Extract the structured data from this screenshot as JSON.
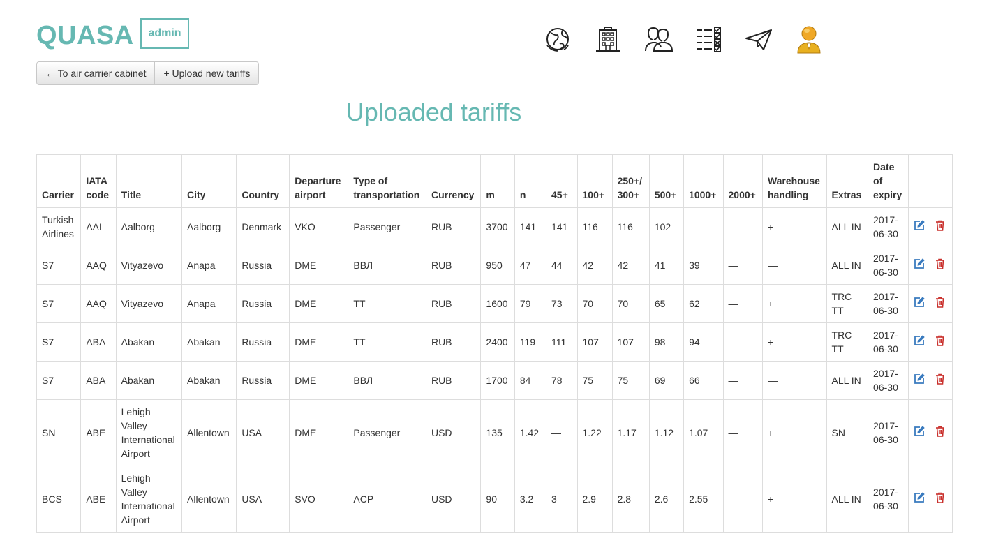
{
  "brand": {
    "logo": "QUASA",
    "role": "admin"
  },
  "toolbar": {
    "back_label": "← To air carrier cabinet",
    "upload_label": "+ Upload new tariffs"
  },
  "nav_icons": [
    "globe-icon",
    "building-icon",
    "users-icon",
    "checklist-icon",
    "paper-plane-icon",
    "user-avatar-icon"
  ],
  "colors": {
    "accent": "#66b8b2",
    "edit": "#3a7bbf",
    "delete": "#c9302c",
    "avatar": "#e8b020"
  },
  "page": {
    "title": "Uploaded tariffs"
  },
  "table": {
    "headers": [
      "Carrier",
      "IATA code",
      "Title",
      "City",
      "Country",
      "Departure airport",
      "Type of transportation",
      "Currency",
      "m",
      "n",
      "45+",
      "100+",
      "250+/ 300+",
      "500+",
      "1000+",
      "2000+",
      "Warehouse handling",
      "Extras",
      "Date of expiry"
    ],
    "rows": [
      [
        "Turkish Airlines",
        "AAL",
        "Aalborg",
        "Aalborg",
        "Denmark",
        "VKO",
        "Passenger",
        "RUB",
        "3700",
        "141",
        "141",
        "116",
        "116",
        "102",
        "—",
        "—",
        "+",
        "ALL IN",
        "2017-06-30"
      ],
      [
        "S7",
        "AAQ",
        "Vityazevo",
        "Anapa",
        "Russia",
        "DME",
        "ВВЛ",
        "RUB",
        "950",
        "47",
        "44",
        "42",
        "42",
        "41",
        "39",
        "—",
        "—",
        "ALL IN",
        "2017-06-30"
      ],
      [
        "S7",
        "AAQ",
        "Vityazevo",
        "Anapa",
        "Russia",
        "DME",
        "TT",
        "RUB",
        "1600",
        "79",
        "73",
        "70",
        "70",
        "65",
        "62",
        "—",
        "+",
        "TRC TT",
        "2017-06-30"
      ],
      [
        "S7",
        "ABA",
        "Abakan",
        "Abakan",
        "Russia",
        "DME",
        "TT",
        "RUB",
        "2400",
        "119",
        "111",
        "107",
        "107",
        "98",
        "94",
        "—",
        "+",
        "TRC TT",
        "2017-06-30"
      ],
      [
        "S7",
        "ABA",
        "Abakan",
        "Abakan",
        "Russia",
        "DME",
        "ВВЛ",
        "RUB",
        "1700",
        "84",
        "78",
        "75",
        "75",
        "69",
        "66",
        "—",
        "—",
        "ALL IN",
        "2017-06-30"
      ],
      [
        "SN",
        "ABE",
        "Lehigh Valley International Airport",
        "Allentown",
        "USA",
        "DME",
        "Passenger",
        "USD",
        "135",
        "1.42",
        "—",
        "1.22",
        "1.17",
        "1.12",
        "1.07",
        "—",
        "+",
        "SN",
        "2017-06-30"
      ],
      [
        "BCS",
        "ABE",
        "Lehigh Valley International Airport",
        "Allentown",
        "USA",
        "SVO",
        "ACP",
        "USD",
        "90",
        "3.2",
        "3",
        "2.9",
        "2.8",
        "2.6",
        "2.55",
        "—",
        "+",
        "ALL IN",
        "2017-06-30"
      ]
    ]
  }
}
